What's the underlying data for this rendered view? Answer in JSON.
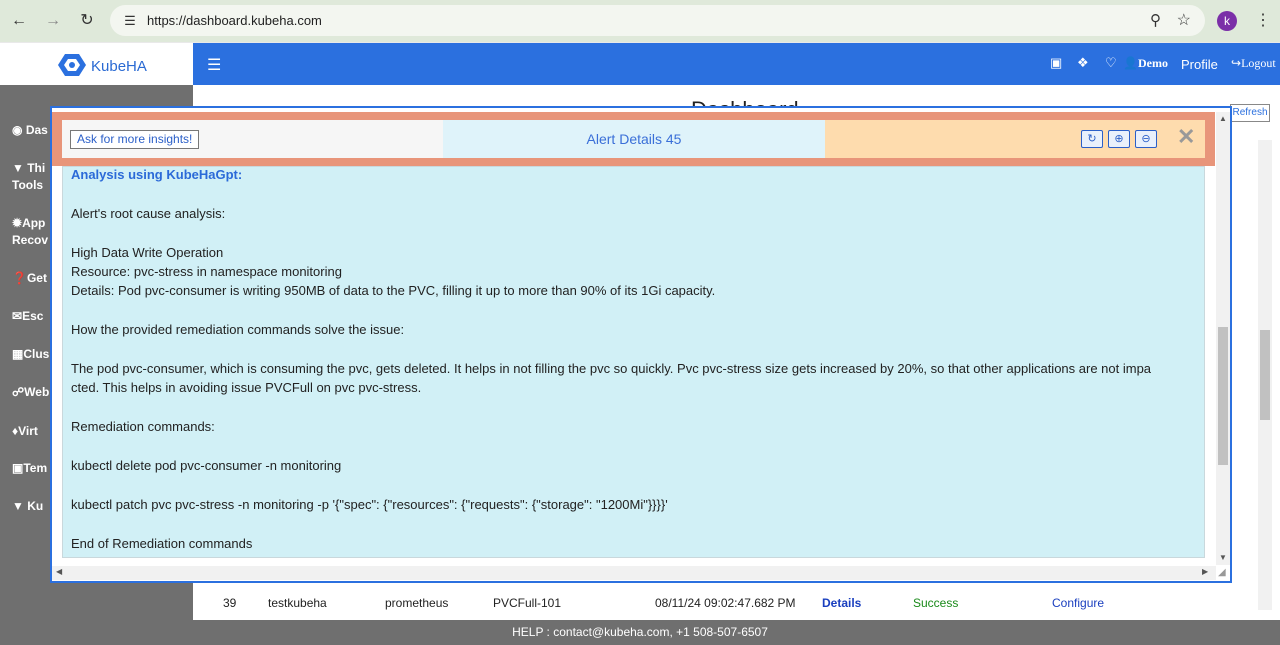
{
  "browser": {
    "url": "https://dashboard.kubeha.com",
    "account_initial": "k"
  },
  "brand": {
    "name": "KubeHA",
    "accent": "#2b70df"
  },
  "header": {
    "user_label": "Demo",
    "profile_label": "Profile",
    "logout_label": "Logout"
  },
  "sidebar": {
    "items": [
      {
        "label": "Das",
        "icon": "dashboard-icon"
      },
      {
        "label": "Thi\nTools",
        "icon": "caret-down-icon"
      },
      {
        "label": "App\nRecov",
        "icon": "gear-icon"
      },
      {
        "label": "Get",
        "icon": "question-icon"
      },
      {
        "label": "Esc",
        "icon": "envelope-icon"
      },
      {
        "label": "Clus",
        "icon": "database-icon"
      },
      {
        "label": "Web",
        "icon": "link-icon"
      },
      {
        "label": "Virt",
        "icon": "cubes-icon"
      },
      {
        "label": "Tem",
        "icon": "template-icon"
      },
      {
        "label": "Ku",
        "icon": "caret-down-icon"
      }
    ]
  },
  "main": {
    "title": "Dashboard",
    "refresh_label": "Refresh",
    "row": {
      "id": "39",
      "cluster": "testkubeha",
      "source": "prometheus",
      "alert": "PVCFull-101",
      "time": "08/11/24 09:02:47.682 PM",
      "details": "Details",
      "status": "Success",
      "configure": "Configure"
    }
  },
  "modal": {
    "ask_button": "Ask for more insights!",
    "title": "Alert Details 45",
    "lines": [
      "Analysis using KubeHaGpt:",
      "Alert's root cause analysis:",
      "High Data Write Operation",
      "Resource: pvc-stress in namespace monitoring",
      "Details: Pod pvc-consumer is writing 950MB of data to the PVC, filling it up to more than 90% of its 1Gi capacity.",
      "How the provided remediation commands solve the issue:",
      "The pod pvc-consumer, which is consuming the pvc, gets deleted. It helps in not filling the pvc so quickly. Pvc pvc-stress size gets increased by 20%, so that other applications are not impa",
      "cted. This helps in avoiding issue PVCFull on pvc pvc-stress.",
      "Remediation commands:",
      "kubectl delete pod pvc-consumer -n monitoring",
      "kubectl patch pvc pvc-stress -n monitoring -p '{\"spec\": {\"resources\": {\"requests\": {\"storage\": \"1200Mi\"}}}}'",
      "End of Remediation commands"
    ]
  },
  "footer": {
    "text": "HELP : contact@kubeha.com, +1 508-507-6507"
  }
}
